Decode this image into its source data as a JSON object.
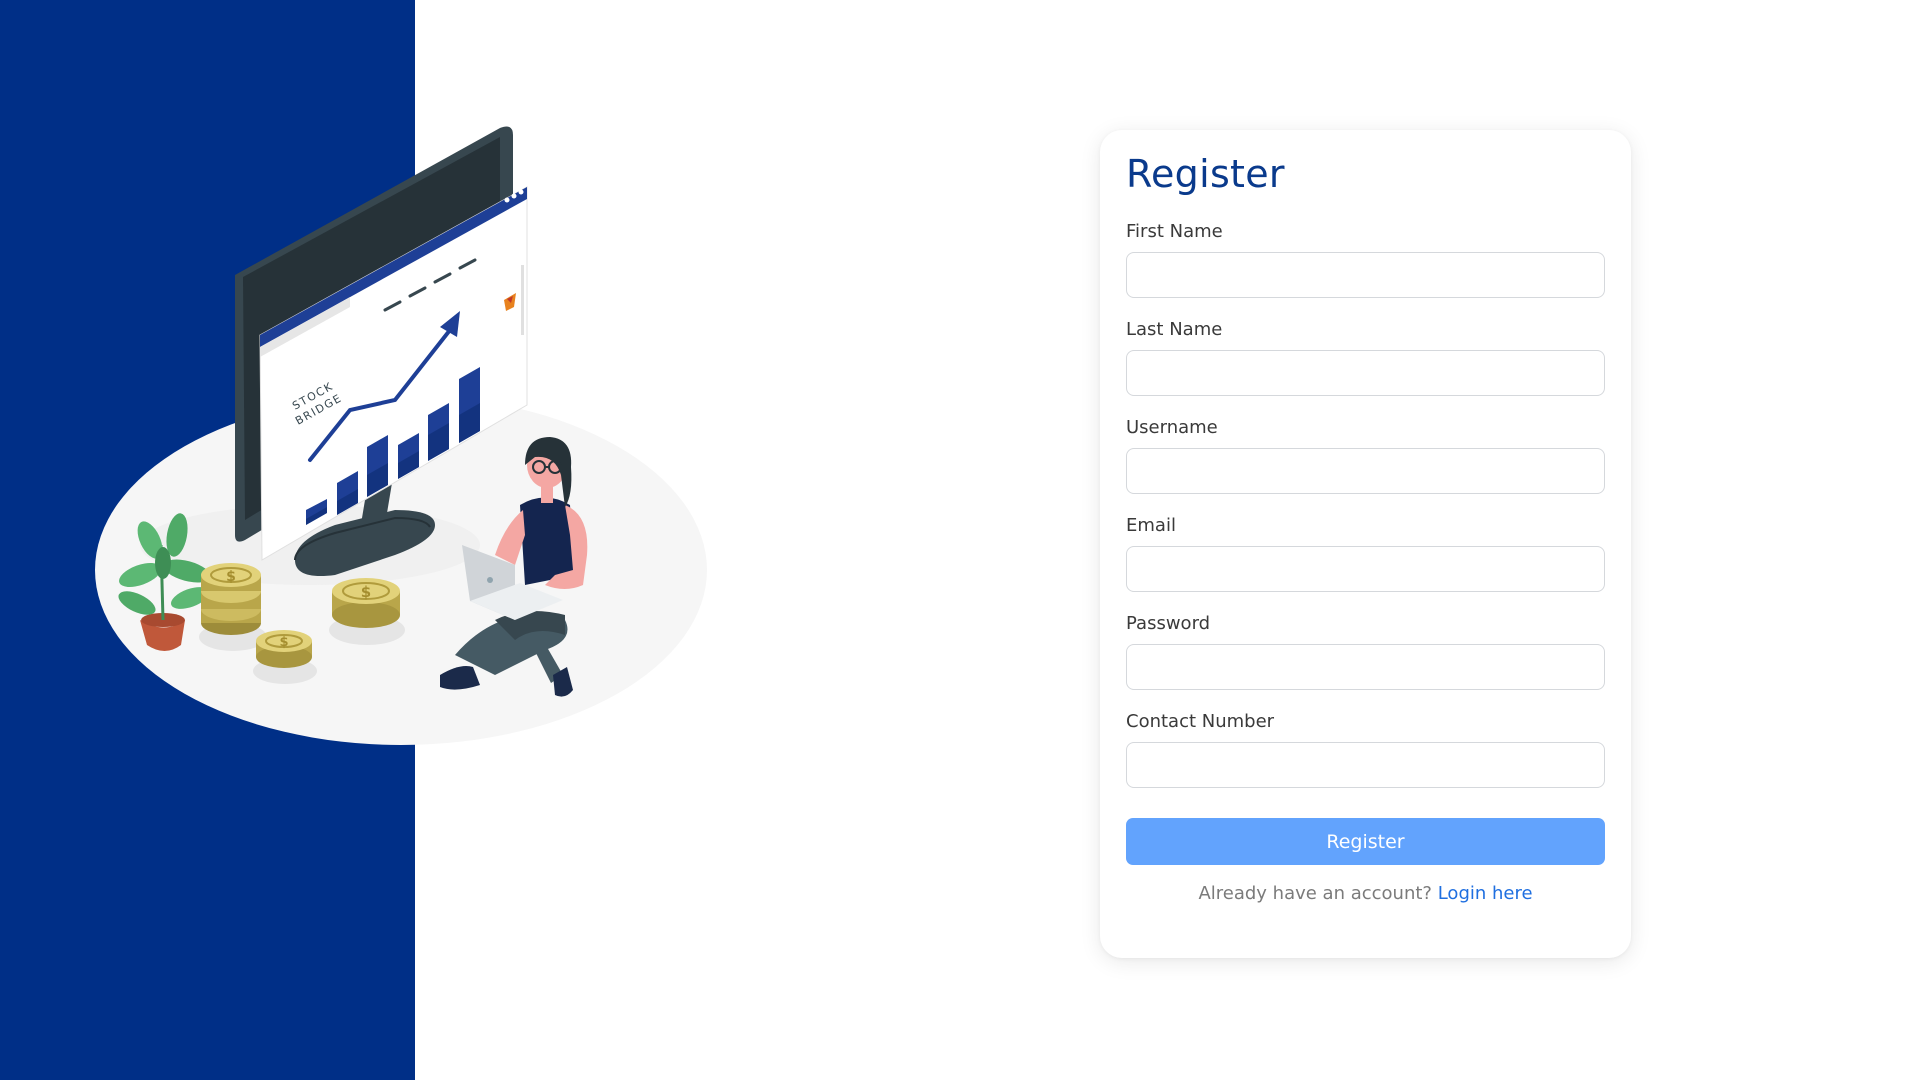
{
  "illustration": {
    "monitor_text_line1": "STOCK",
    "monitor_text_line2": "BRIDGE",
    "coin_symbol": "$"
  },
  "form": {
    "title": "Register",
    "fields": [
      {
        "label": "First Name",
        "value": "",
        "placeholder": ""
      },
      {
        "label": "Last Name",
        "value": "",
        "placeholder": ""
      },
      {
        "label": "Username",
        "value": "",
        "placeholder": ""
      },
      {
        "label": "Email",
        "value": "",
        "placeholder": ""
      },
      {
        "label": "Password",
        "value": "",
        "placeholder": ""
      },
      {
        "label": "Contact Number",
        "value": "",
        "placeholder": ""
      }
    ],
    "submit_label": "Register",
    "login_prompt": "Already have an account?",
    "login_link": "Login here"
  },
  "colors": {
    "brand_navy": "#002f87",
    "button_blue": "#62a3fd",
    "link_blue": "#1f6fe0",
    "title_blue": "#0a3a8c"
  }
}
